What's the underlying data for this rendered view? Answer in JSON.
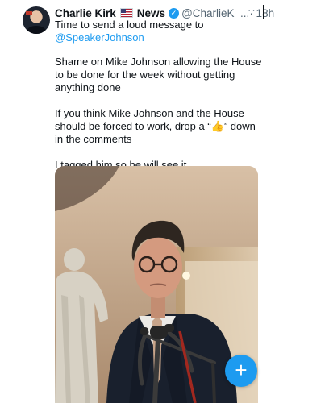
{
  "tweet": {
    "author_name": "Charlie Kirk",
    "badge": "News",
    "handle": "@CharlieK_...",
    "time": "· 18h",
    "more_icon": "···",
    "line1": "Time to send a loud message to",
    "mention": "@SpeakerJohnson",
    "paragraph2": "Shame on Mike Johnson allowing the House to be done for the week without getting anything done",
    "paragraph3_before": "If you think Mike Johnson and the House should be forced to work, drop a “",
    "paragraph3_emoji": "👍",
    "paragraph3_after": "” down in the comments",
    "paragraph4": "I tagged him so he will see it"
  },
  "fab": {
    "label": "+"
  },
  "colors": {
    "accent": "#1d9bf0",
    "text": "#0f1419",
    "muted": "#536471"
  }
}
